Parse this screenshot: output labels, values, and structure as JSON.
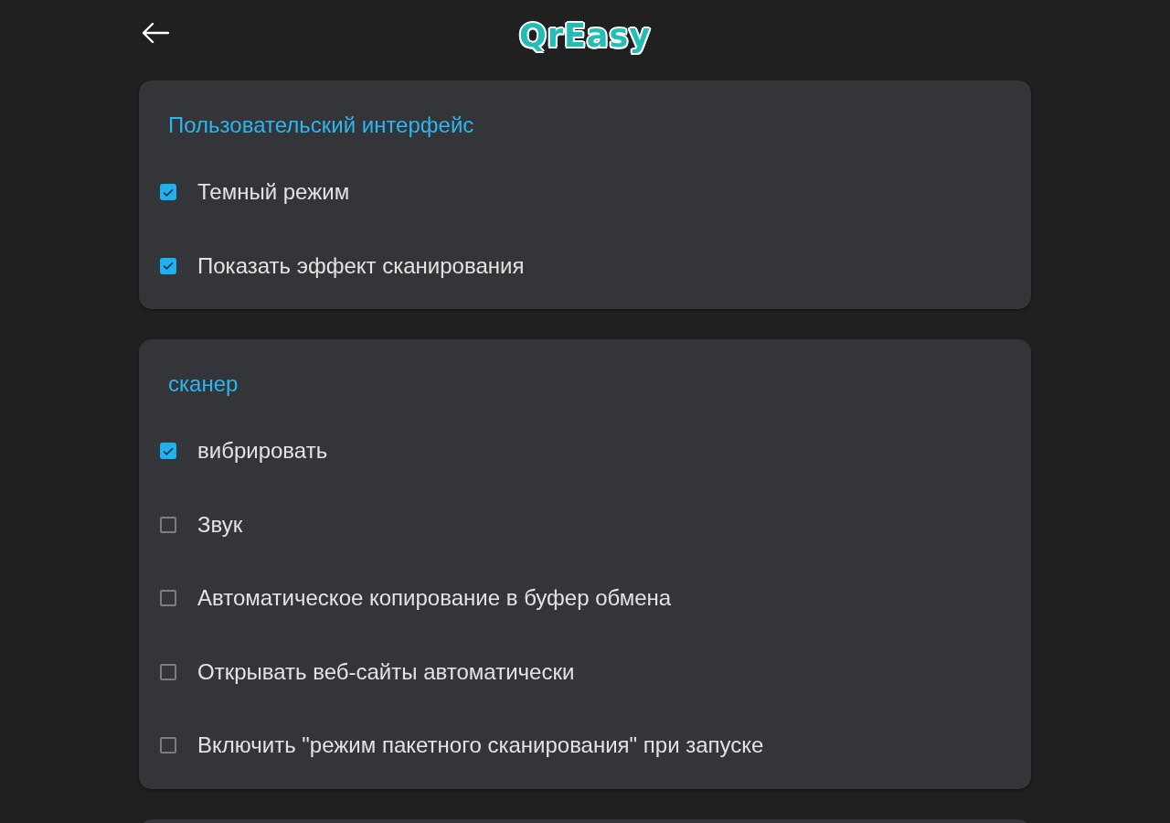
{
  "header": {
    "logo": "QrEasy"
  },
  "sections": [
    {
      "title": "Пользовательский интерфейс",
      "items": [
        {
          "label": "Темный режим",
          "checked": true
        },
        {
          "label": "Показать эффект сканирования",
          "checked": true
        }
      ]
    },
    {
      "title": "сканер",
      "items": [
        {
          "label": "вибрировать",
          "checked": true
        },
        {
          "label": "Звук",
          "checked": false
        },
        {
          "label": "Автоматическое копирование в буфер обмена",
          "checked": false
        },
        {
          "label": "Открывать веб-сайты автоматически",
          "checked": false
        },
        {
          "label": "Включить \"режим пакетного сканирования\" при запуске",
          "checked": false
        }
      ]
    }
  ],
  "more_cards_below": true
}
